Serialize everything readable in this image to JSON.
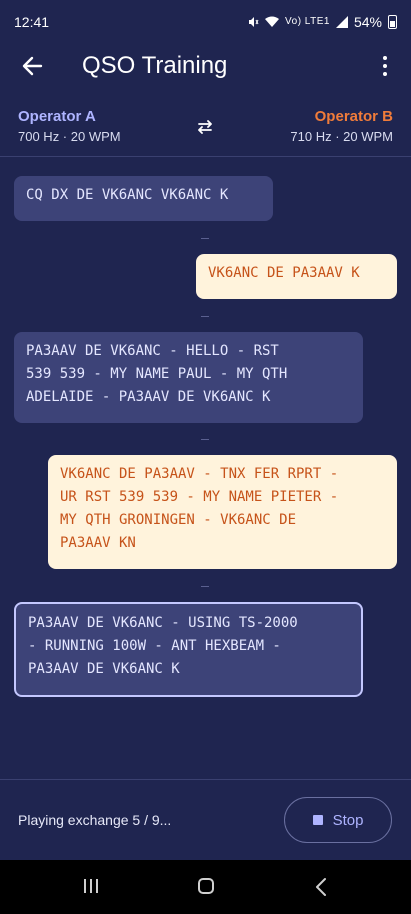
{
  "status_bar": {
    "time": "12:41",
    "network_icons": "Vo) LTE1",
    "battery": "54%"
  },
  "app_bar": {
    "title": "QSO Training",
    "back_icon": "arrow-back-icon",
    "menu_icon": "more-vert-icon"
  },
  "operators": {
    "a": {
      "name": "Operator A",
      "settings": "700 Hz · 20 WPM"
    },
    "b": {
      "name": "Operator B",
      "settings": "710 Hz · 20 WPM"
    },
    "swap_icon": "swap-horiz-icon"
  },
  "messages": [
    {
      "from": "A",
      "text": "CQ DX DE VK6ANC VK6ANC K"
    },
    {
      "from": "B",
      "text": "VK6ANC DE PA3AAV K"
    },
    {
      "from": "A",
      "text": "PA3AAV DE VK6ANC - HELLO - RST\n539 539 - MY NAME PAUL - MY QTH\nADELAIDE - PA3AAV DE VK6ANC K"
    },
    {
      "from": "B",
      "text": "VK6ANC DE PA3AAV - TNX FER RPRT -\nUR RST 539 539 - MY NAME PIETER -\nMY QTH GRONINGEN - VK6ANC DE\nPA3AAV KN"
    },
    {
      "from": "A",
      "text": "PA3AAV DE VK6ANC - USING TS-2000\n- RUNNING 100W - ANT HEXBEAM -\nPA3AAV DE VK6ANC K",
      "active": true
    }
  ],
  "footer": {
    "status": "Playing exchange 5 / 9...",
    "stop_label": "Stop"
  },
  "colors": {
    "background": "#1f2550",
    "operator_a": "#aeb4ff",
    "operator_b": "#f07c3a",
    "bubble_a": "#3d4378",
    "bubble_b": "#fff3dc"
  }
}
